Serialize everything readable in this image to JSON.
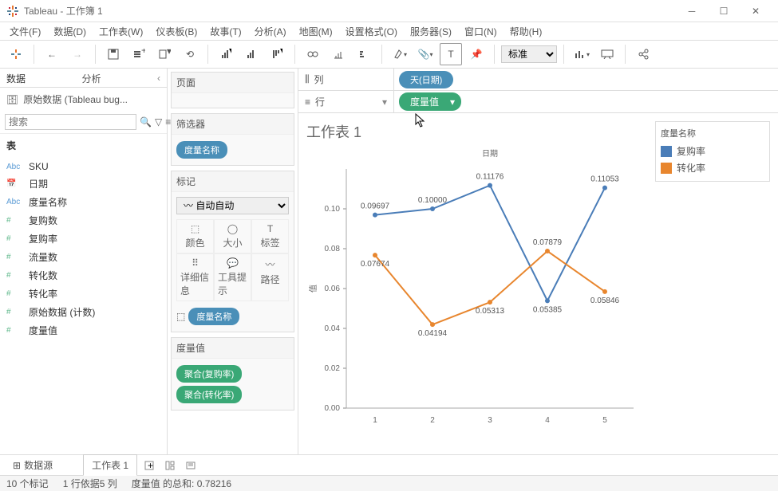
{
  "window": {
    "title": "Tableau - 工作簿 1"
  },
  "menu": [
    "文件(F)",
    "数据(D)",
    "工作表(W)",
    "仪表板(B)",
    "故事(T)",
    "分析(A)",
    "地图(M)",
    "设置格式(O)",
    "服务器(S)",
    "窗口(N)",
    "帮助(H)"
  ],
  "toolbar": {
    "fit": "标准"
  },
  "leftpanel": {
    "tabs": {
      "data": "数据",
      "analytics": "分析"
    },
    "datasource": "原始数据 (Tableau bug...",
    "search_placeholder": "搜索",
    "tables_heading": "表",
    "fields": [
      {
        "type": "Abc",
        "name": "SKU",
        "cls": ""
      },
      {
        "type": "📅",
        "name": "日期",
        "cls": ""
      },
      {
        "type": "Abc",
        "name": "度量名称",
        "cls": ""
      },
      {
        "type": "#",
        "name": "复购数",
        "cls": "num"
      },
      {
        "type": "#",
        "name": "复购率",
        "cls": "num"
      },
      {
        "type": "#",
        "name": "流量数",
        "cls": "num"
      },
      {
        "type": "#",
        "name": "转化数",
        "cls": "num"
      },
      {
        "type": "#",
        "name": "转化率",
        "cls": "num"
      },
      {
        "type": "#",
        "name": "原始数据 (计数)",
        "cls": "num"
      },
      {
        "type": "#",
        "name": "度量值",
        "cls": "num"
      }
    ]
  },
  "midpanel": {
    "pages": "页面",
    "filters": "筛选器",
    "filter_pill": "度量名称",
    "marks": "标记",
    "marks_mode": "自动",
    "marks_cells": [
      "颜色",
      "大小",
      "标签",
      "详细信息",
      "工具提示",
      "路径"
    ],
    "marks_pill": "度量名称",
    "measures_h": "度量值",
    "measure_pills": [
      "聚合(复购率)",
      "聚合(转化率)"
    ]
  },
  "shelves": {
    "columns_label": "列",
    "columns_pill": "天(日期)",
    "rows_label": "行",
    "rows_pill": "度量值"
  },
  "chart": {
    "title": "工作表 1",
    "x_title": "日期",
    "y_title": "值",
    "legend_title": "度量名称",
    "legend": [
      {
        "name": "复购率",
        "color": "#4a7db8"
      },
      {
        "name": "转化率",
        "color": "#e8862e"
      }
    ]
  },
  "chart_data": {
    "type": "line",
    "categories": [
      1,
      2,
      3,
      4,
      5
    ],
    "x_title": "日期",
    "y_title": "值",
    "ylim": [
      0.0,
      0.12
    ],
    "yticks": [
      0.0,
      0.02,
      0.04,
      0.06,
      0.08,
      0.1
    ],
    "series": [
      {
        "name": "复购率",
        "color": "#4a7db8",
        "values": [
          0.09697,
          0.1,
          0.11176,
          0.05385,
          0.11053
        ]
      },
      {
        "name": "转化率",
        "color": "#e8862e",
        "values": [
          0.07674,
          0.04194,
          0.05313,
          0.07879,
          0.05846
        ]
      }
    ]
  },
  "tabs": {
    "datasource": "数据源",
    "sheet": "工作表 1"
  },
  "status": {
    "marks": "10 个标记",
    "rowcol": "1 行依据5 列",
    "sum": "度量值 的总和: 0.78216"
  }
}
